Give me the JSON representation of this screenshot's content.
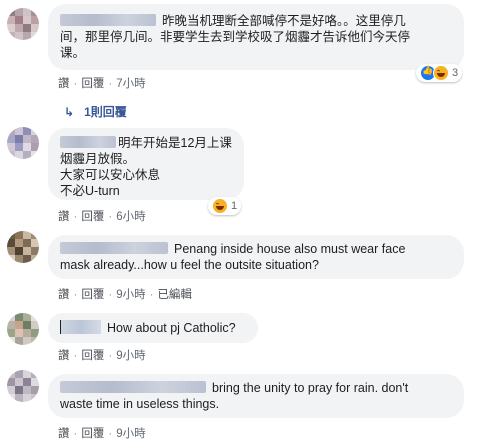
{
  "comments": [
    {
      "text_line1": "昨晚当机理断全部喊停不是好咯。。这里停几",
      "text_line2": "间，那里停几间。非要学生去到学校吸了烟霾才告诉他们今天停",
      "text_line3": "课。",
      "actions": {
        "like": "讚",
        "reply": "回覆",
        "time": "7小時"
      },
      "reactions": {
        "icons": [
          "like-icon",
          "haha-icon"
        ],
        "count": "3"
      },
      "replies_link": "1則回覆"
    },
    {
      "text_line1": "明年开始是12月上课",
      "text_line2": "烟霾月放假。",
      "text_line3": "大家可以安心休息",
      "text_line4": "不必U-turn",
      "actions": {
        "like": "讚",
        "reply": "回覆",
        "time": "6小時"
      },
      "reactions": {
        "icons": [
          "haha-icon"
        ],
        "count": "1"
      }
    },
    {
      "text_line1": "Penang inside house also must wear face",
      "text_line2": "mask already...how u feel the outsite situation?",
      "actions": {
        "like": "讚",
        "reply": "回覆",
        "time": "9小時",
        "edited": "已編輯"
      }
    },
    {
      "text_line1": "How about pj Catholic?",
      "actions": {
        "like": "讚",
        "reply": "回覆",
        "time": "9小時"
      }
    },
    {
      "text_line1": "bring the unity to pray for rain. don't",
      "text_line2": "waste time in useless things.",
      "actions": {
        "like": "讚",
        "reply": "回覆",
        "time": "9小時"
      }
    }
  ],
  "colors": {
    "bubble_bg": "#f2f3f5",
    "link_blue": "#385898",
    "meta_gray": "#606770"
  }
}
